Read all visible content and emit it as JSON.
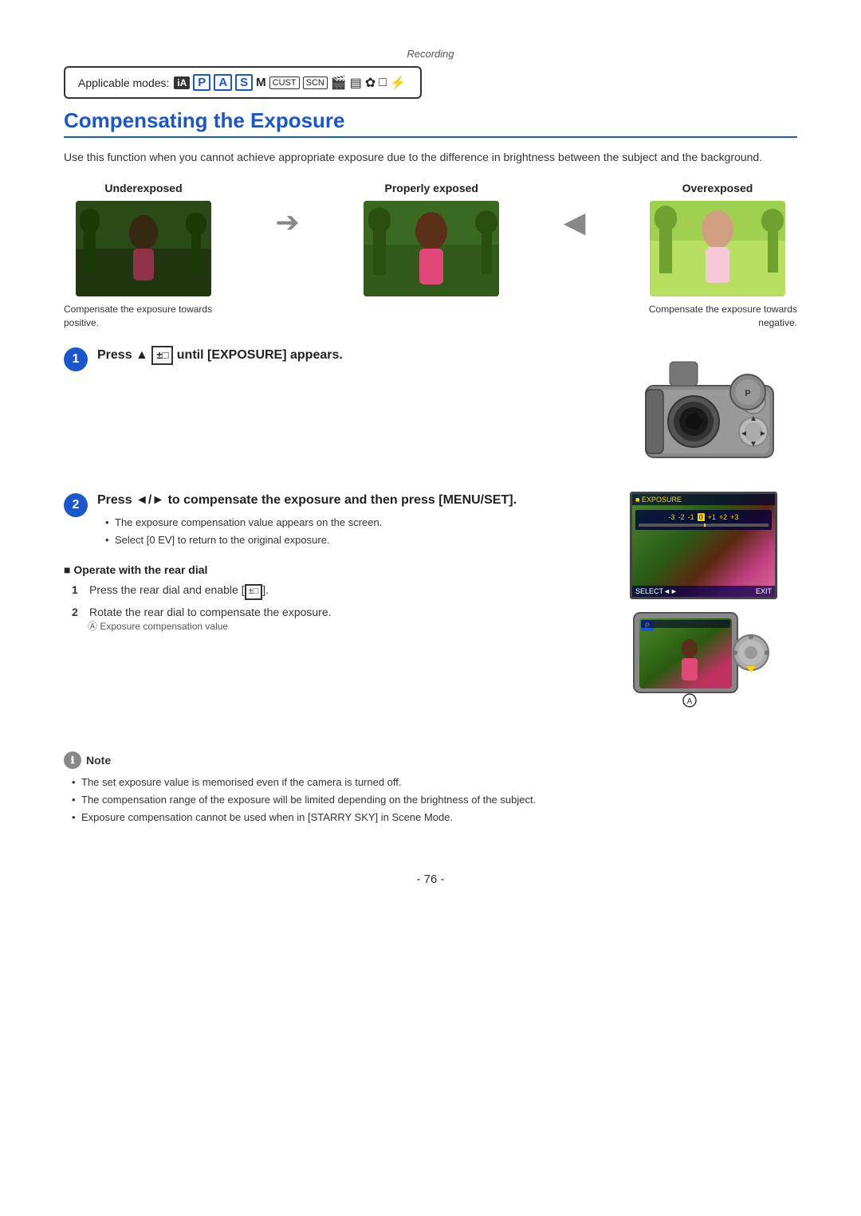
{
  "page": {
    "recording_label": "Recording",
    "applicable_label": "Applicable modes:",
    "section_title": "Compensating the Exposure",
    "intro_text": "Use this function when you cannot achieve appropriate exposure due to the difference in brightness between the subject and the background.",
    "modes": [
      "iA",
      "P",
      "A",
      "S",
      "M",
      "CUST",
      "SCN",
      "movie",
      "pano",
      "scene1",
      "scene2",
      "custom2"
    ],
    "examples": {
      "underexposed_label": "Underexposed",
      "properly_exposed_label": "Properly exposed",
      "overexposed_label": "Overexposed",
      "caption_positive": "Compensate the exposure towards positive.",
      "caption_negative": "Compensate the exposure towards negative."
    },
    "step1": {
      "number": "1",
      "text": "Press ▲ [±□] until [EXPOSURE] appears."
    },
    "step2": {
      "number": "2",
      "text": "Press ◄/► to compensate the exposure and then press [MENU/SET].",
      "bullets": [
        "The exposure compensation value appears on the screen.",
        "Select [0 EV] to return to the original exposure."
      ]
    },
    "operate": {
      "title": "Operate with the rear dial",
      "step1": "Press the rear dial and enable [±□].",
      "step2": "Rotate the rear dial to compensate the exposure.",
      "step1_num": "1",
      "step2_num": "2",
      "sub_note": "Ⓐ Exposure compensation value"
    },
    "note": {
      "title": "Note",
      "bullets": [
        "The set exposure value is memorised even if the camera is turned off.",
        "The compensation range of the exposure will be limited depending on the brightness of the subject.",
        "Exposure compensation cannot be used when in [STARRY SKY] in Scene Mode."
      ]
    },
    "page_number": "- 76 -"
  }
}
